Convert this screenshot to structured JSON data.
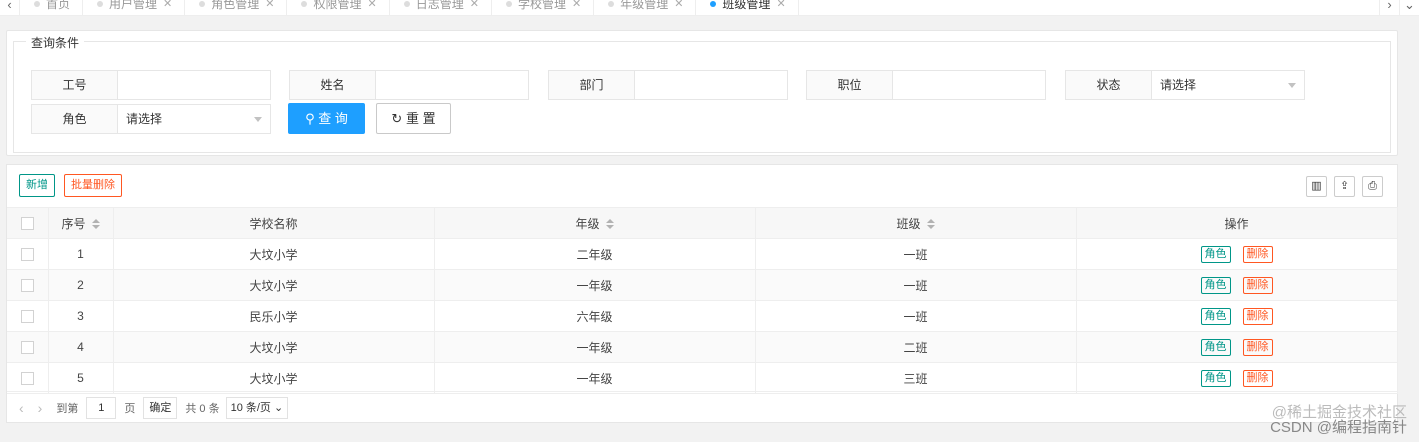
{
  "tabs": [
    {
      "label": "首页",
      "closable": false,
      "active": false
    },
    {
      "label": "用户管理",
      "closable": true,
      "active": false
    },
    {
      "label": "角色管理",
      "closable": true,
      "active": false
    },
    {
      "label": "权限管理",
      "closable": true,
      "active": false
    },
    {
      "label": "日志管理",
      "closable": true,
      "active": false
    },
    {
      "label": "学校管理",
      "closable": true,
      "active": false
    },
    {
      "label": "年级管理",
      "closable": true,
      "active": false
    },
    {
      "label": "班级管理",
      "closable": true,
      "active": true
    }
  ],
  "search": {
    "legend": "查询条件",
    "fields": {
      "jobno": {
        "label": "工号",
        "value": ""
      },
      "name": {
        "label": "姓名",
        "value": ""
      },
      "dept": {
        "label": "部门",
        "value": ""
      },
      "position": {
        "label": "职位",
        "value": ""
      },
      "status": {
        "label": "状态",
        "value": "请选择"
      },
      "role": {
        "label": "角色",
        "value": "请选择"
      }
    },
    "query_label": "查 询",
    "reset_label": "重 置"
  },
  "toolbar": {
    "add_label": "新增",
    "batch_delete_label": "批量删除"
  },
  "table": {
    "headers": {
      "index": "序号",
      "school": "学校名称",
      "grade": "年级",
      "class": "班级",
      "ops": "操作"
    },
    "rows": [
      {
        "index": "1",
        "school": "大坟小学",
        "grade": "二年级",
        "class": "一班"
      },
      {
        "index": "2",
        "school": "大坟小学",
        "grade": "一年级",
        "class": "一班"
      },
      {
        "index": "3",
        "school": "民乐小学",
        "grade": "六年级",
        "class": "一班"
      },
      {
        "index": "4",
        "school": "大坟小学",
        "grade": "一年级",
        "class": "二班"
      },
      {
        "index": "5",
        "school": "大坟小学",
        "grade": "一年级",
        "class": "三班"
      }
    ],
    "role_label": "角色",
    "delete_label": "删除"
  },
  "pager": {
    "goto_label": "到第",
    "page_value": "1",
    "page_label": "页",
    "confirm_label": "确定",
    "total_label": "共 0 条",
    "page_size": "10 条/页"
  },
  "watermark": {
    "line1": "@稀土掘金技术社区",
    "line2": "CSDN @编程指南针"
  }
}
